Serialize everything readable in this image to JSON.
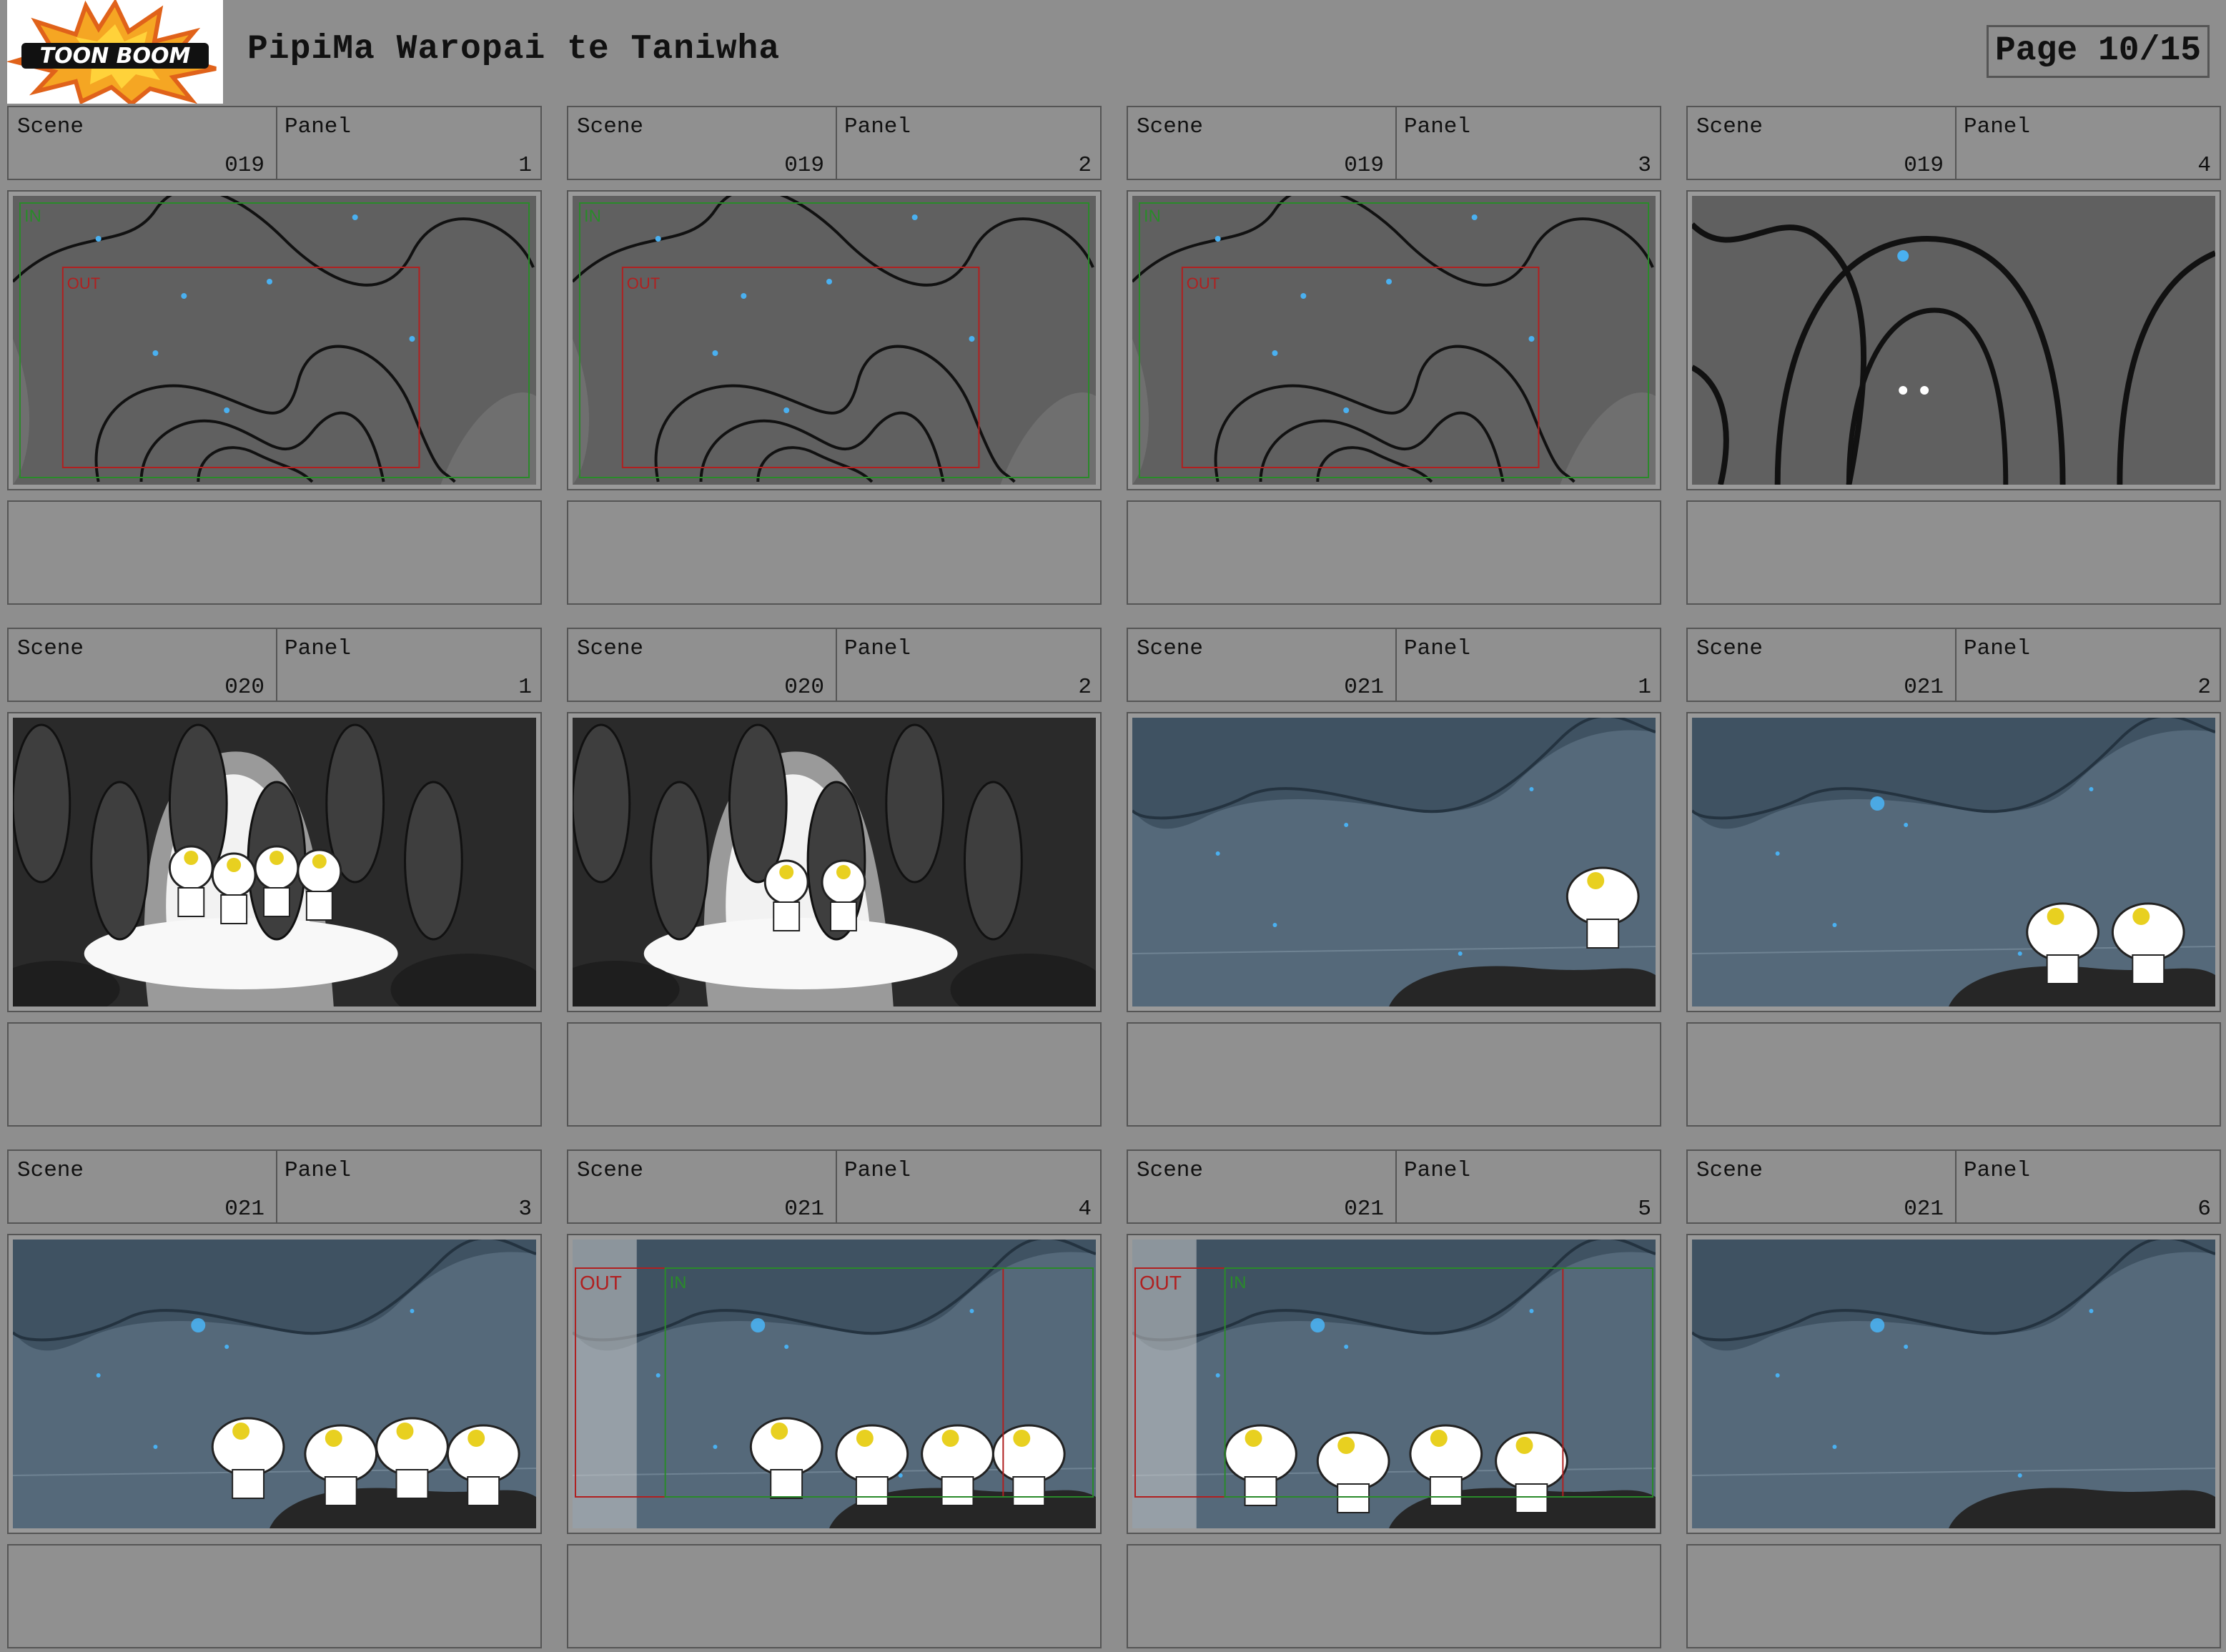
{
  "header": {
    "logo_text": "TOON BOOM",
    "title": "PipiMa Waropai te Taniwha",
    "page": "Page 10/15"
  },
  "labels": {
    "scene": "Scene",
    "panel": "Panel"
  },
  "colors": {
    "background": "#8e8e8e",
    "cave_sketch": "#606060",
    "cave_color": "#55697a",
    "out_frame": "#b02020",
    "in_frame": "#2a8a2a",
    "glow": "#4ab0f0"
  },
  "panels": [
    {
      "scene": "019",
      "panel": "1",
      "style": "sketch",
      "frame_labels": [
        "IN",
        "OUT"
      ]
    },
    {
      "scene": "019",
      "panel": "2",
      "style": "sketch",
      "frame_labels": [
        "IN",
        "OUT"
      ]
    },
    {
      "scene": "019",
      "panel": "3",
      "style": "sketch",
      "frame_labels": [
        "IN",
        "OUT"
      ]
    },
    {
      "scene": "019",
      "panel": "4",
      "style": "sketch-eyes",
      "frame_labels": []
    },
    {
      "scene": "020",
      "panel": "1",
      "style": "cave-mouth",
      "frame_labels": []
    },
    {
      "scene": "020",
      "panel": "2",
      "style": "cave-mouth",
      "frame_labels": []
    },
    {
      "scene": "021",
      "panel": "1",
      "style": "blue-cave",
      "frame_labels": []
    },
    {
      "scene": "021",
      "panel": "2",
      "style": "blue-cave",
      "frame_labels": []
    },
    {
      "scene": "021",
      "panel": "3",
      "style": "blue-cave",
      "frame_labels": []
    },
    {
      "scene": "021",
      "panel": "4",
      "style": "blue-cave",
      "frame_labels": [
        "OUT",
        "IN"
      ]
    },
    {
      "scene": "021",
      "panel": "5",
      "style": "blue-cave",
      "frame_labels": [
        "OUT",
        "IN"
      ]
    },
    {
      "scene": "021",
      "panel": "6",
      "style": "blue-cave",
      "frame_labels": []
    }
  ]
}
